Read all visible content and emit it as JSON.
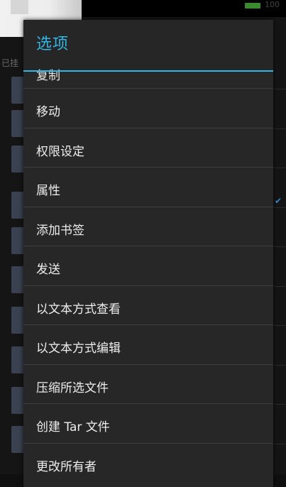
{
  "status_bar": {
    "battery_text": "100"
  },
  "background": {
    "left_label": "已挂"
  },
  "dialog": {
    "title": "选项",
    "partial_item": "复制",
    "items": [
      {
        "label": "移动"
      },
      {
        "label": "权限设定"
      },
      {
        "label": "属性"
      },
      {
        "label": "添加书签"
      },
      {
        "label": "发送"
      },
      {
        "label": "以文本方式查看"
      },
      {
        "label": "以文本方式编辑"
      },
      {
        "label": "压缩所选文件"
      },
      {
        "label": "创建 Tar 文件"
      },
      {
        "label": "更改所有者"
      }
    ]
  },
  "colors": {
    "accent": "#33b5e5",
    "dialog_bg": "#272727",
    "text": "#eeeeee"
  }
}
